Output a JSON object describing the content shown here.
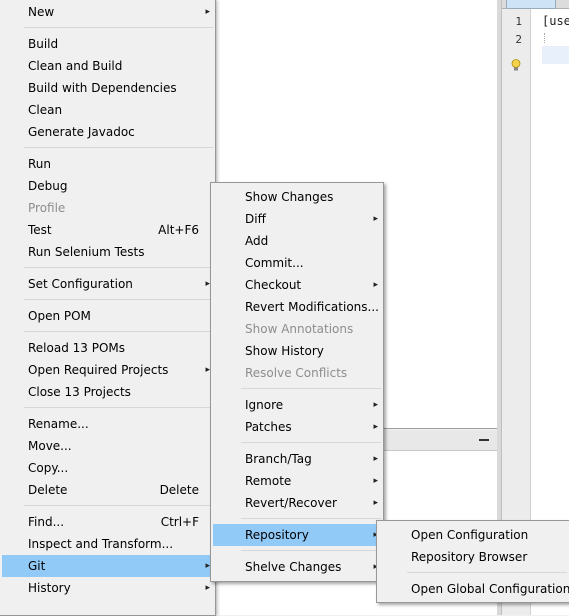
{
  "editor": {
    "line_numbers": [
      "1",
      "2"
    ],
    "code_line_1": "[use"
  },
  "main_menu": [
    {
      "id": "new",
      "label": "New",
      "submenu": true
    },
    {
      "sep": true
    },
    {
      "id": "build",
      "label": "Build"
    },
    {
      "id": "clean-and-build",
      "label": "Clean and Build"
    },
    {
      "id": "build-with-dependencies",
      "label": "Build with Dependencies"
    },
    {
      "id": "clean",
      "label": "Clean"
    },
    {
      "id": "generate-javadoc",
      "label": "Generate Javadoc"
    },
    {
      "sep": true
    },
    {
      "id": "run",
      "label": "Run"
    },
    {
      "id": "debug",
      "label": "Debug"
    },
    {
      "id": "profile",
      "label": "Profile",
      "disabled": true
    },
    {
      "id": "test",
      "label": "Test",
      "shortcut": "Alt+F6"
    },
    {
      "id": "run-selenium-tests",
      "label": "Run Selenium Tests"
    },
    {
      "sep": true
    },
    {
      "id": "set-configuration",
      "label": "Set Configuration",
      "submenu": true
    },
    {
      "sep": true
    },
    {
      "id": "open-pom",
      "label": "Open POM"
    },
    {
      "sep": true
    },
    {
      "id": "reload-poms",
      "label": "Reload 13 POMs"
    },
    {
      "id": "open-required-projects",
      "label": "Open Required Projects",
      "submenu": true
    },
    {
      "id": "close-projects",
      "label": "Close 13 Projects"
    },
    {
      "sep": true
    },
    {
      "id": "rename",
      "label": "Rename..."
    },
    {
      "id": "move",
      "label": "Move..."
    },
    {
      "id": "copy",
      "label": "Copy..."
    },
    {
      "id": "delete",
      "label": "Delete",
      "shortcut": "Delete"
    },
    {
      "sep": true
    },
    {
      "id": "find",
      "label": "Find...",
      "shortcut": "Ctrl+F"
    },
    {
      "id": "inspect-and-transform",
      "label": "Inspect and Transform..."
    },
    {
      "id": "git",
      "label": "Git",
      "submenu": true,
      "highlighted": true
    },
    {
      "id": "history",
      "label": "History",
      "submenu": true
    }
  ],
  "git_menu": [
    {
      "id": "show-changes",
      "label": "Show Changes"
    },
    {
      "id": "diff",
      "label": "Diff",
      "submenu": true
    },
    {
      "id": "add",
      "label": "Add"
    },
    {
      "id": "commit",
      "label": "Commit..."
    },
    {
      "id": "checkout",
      "label": "Checkout",
      "submenu": true
    },
    {
      "id": "revert-modifications",
      "label": "Revert Modifications..."
    },
    {
      "id": "show-annotations",
      "label": "Show Annotations",
      "disabled": true
    },
    {
      "id": "show-history",
      "label": "Show History"
    },
    {
      "id": "resolve-conflicts",
      "label": "Resolve Conflicts",
      "disabled": true
    },
    {
      "sep": true
    },
    {
      "id": "ignore",
      "label": "Ignore",
      "submenu": true
    },
    {
      "id": "patches",
      "label": "Patches",
      "submenu": true
    },
    {
      "sep": true
    },
    {
      "id": "branch-tag",
      "label": "Branch/Tag",
      "submenu": true
    },
    {
      "id": "remote",
      "label": "Remote",
      "submenu": true
    },
    {
      "id": "revert-recover",
      "label": "Revert/Recover",
      "submenu": true
    },
    {
      "sep": true
    },
    {
      "id": "repository",
      "label": "Repository",
      "submenu": true,
      "highlighted": true
    },
    {
      "sep": true
    },
    {
      "id": "shelve-changes",
      "label": "Shelve Changes",
      "submenu": true
    }
  ],
  "repository_menu": [
    {
      "id": "open-configuration",
      "label": "Open Configuration"
    },
    {
      "id": "repository-browser",
      "label": "Repository Browser"
    },
    {
      "sep": true
    },
    {
      "id": "open-global-configuration",
      "label": "Open Global Configuration"
    }
  ],
  "colors": {
    "highlight": "#91c9f7",
    "menu_bg": "#f0f0f0",
    "disabled_text": "#8d8d8d"
  }
}
